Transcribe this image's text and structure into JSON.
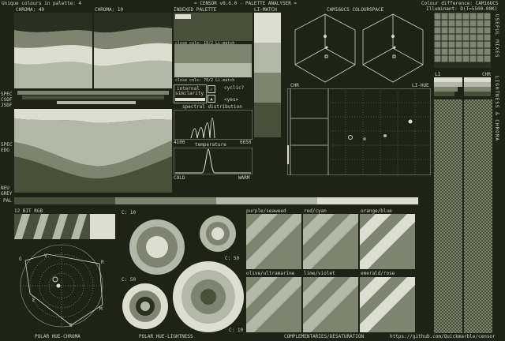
{
  "header": {
    "unique_colours": "Unique colours in palette: 4",
    "app_title": "= CENSOR v0.6.0 - PALETTE ANALYSER =",
    "colour_difference": "Colour difference: CAM16UCS",
    "illuminant": "Illuminant: D(T=5500.00K)",
    "chroma_40": "CHROMA: 40",
    "chroma_10": "CHROMA: 10",
    "indexed_palette": "INDEXED PALETTE",
    "li_match": "LI-MATCH",
    "cam16ucs": "CAM16UCS COLOURSPACE"
  },
  "left_labels": [
    "SPEC",
    "CSDF",
    "JSDF"
  ],
  "left_labels2": [
    "SPEC",
    "EDG"
  ],
  "left_labels3": [
    "NEU",
    "GREY",
    "PAL"
  ],
  "palette_panel": {
    "close_1": "close cols: 10/2 Li-match",
    "close_2": "close cols: 70/2 Li-match",
    "internal": "internal",
    "similarity": "similarity",
    "cyclic": "cyclic?",
    "yes": "<yes>",
    "spectral": "spectral distribution",
    "temperature": "temperature",
    "k_low": "4100",
    "k_high": "6650",
    "cold": "COLD",
    "warm": "WARM"
  },
  "hue_panel": {
    "chr": "CHR",
    "li_hue": "LI-HUE"
  },
  "li_chr": {
    "li": "LI",
    "chr": "CHR"
  },
  "side_vertical": "USEFUL MIXES",
  "side_vertical2": "LIGHTNESS & CHROMA",
  "bottom": {
    "rgb12": "12 BIT RGB",
    "c10a": "C: 10",
    "c50a": "C: 50",
    "c50b": "C: 50",
    "c10b": "C: 10",
    "purple": "purple/seaweed",
    "red": "red/cyan",
    "orange": "orange/blue",
    "olive": "olive/ultramarine",
    "lime": "lime/violet",
    "emerald": "emerald/rose",
    "polar_g": "G",
    "polar_v": "V",
    "polar_r": "R",
    "polar_e": "E",
    "polar_m": "M",
    "polar_b": "B"
  },
  "footer": {
    "f1": "POLAR HUE-CHROMA",
    "f2": "POLAR HUE-LIGHTNESS",
    "f3": "COMPLEMENTARIES/DESATURATION",
    "f4": "https://github.com/Quickmarble/censor"
  },
  "colors": {
    "bg": "#1e2316",
    "dark": "#4a4f3c",
    "mid": "#7e8470",
    "light": "#b4b8a6",
    "pale": "#dcdfd0"
  }
}
